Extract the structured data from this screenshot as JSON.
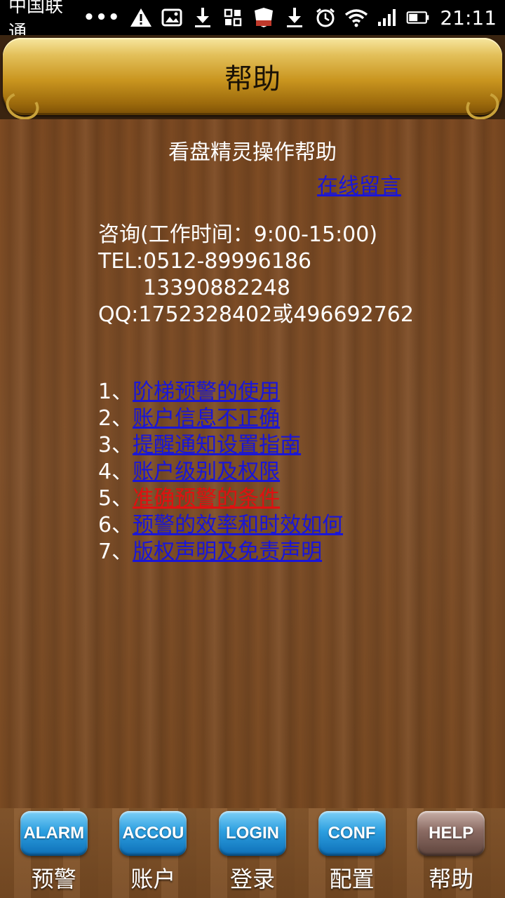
{
  "status_bar": {
    "carrier": "中国联通",
    "dots": "•••",
    "time": "21:11"
  },
  "header": {
    "title": "帮助"
  },
  "main": {
    "heading": "看盘精灵操作帮助",
    "online_message_link": "在线留言",
    "contact": {
      "hours": "咨询(工作时间：9:00-15:00)",
      "tel": "TEL:0512-89996186",
      "tel2": "13390882248",
      "qq": "QQ:1752328402或496692762"
    },
    "topics": [
      {
        "num": "1、",
        "label": "阶梯预警的使用"
      },
      {
        "num": "2、",
        "label": "账户信息不正确"
      },
      {
        "num": "3、",
        "label": "提醒通知设置指南"
      },
      {
        "num": "4、",
        "label": "账户级别及权限"
      },
      {
        "num": "5、",
        "label": "准确预警的条件"
      },
      {
        "num": "6、",
        "label": "预警的效率和时效如何"
      },
      {
        "num": "7、",
        "label": "版权声明及免责声明"
      }
    ]
  },
  "tabbar": {
    "tabs": [
      {
        "button": "ALARM",
        "label": "预警"
      },
      {
        "button": "ACCOU",
        "label": "账户"
      },
      {
        "button": "LOGIN",
        "label": "登录"
      },
      {
        "button": "CONF",
        "label": "配置"
      },
      {
        "button": "HELP",
        "label": "帮助"
      }
    ]
  },
  "colors": {
    "link": "#1a16d8",
    "active_link": "#e01010",
    "tab_button": "#2c9fe0",
    "tab_button_selected": "#8a6a62"
  },
  "icons": [
    "warning-icon",
    "image-icon",
    "download-icon",
    "grid-icon",
    "shield-icon",
    "download-icon",
    "alarm-clock-icon",
    "wifi-icon",
    "signal-icon",
    "battery-icon"
  ]
}
